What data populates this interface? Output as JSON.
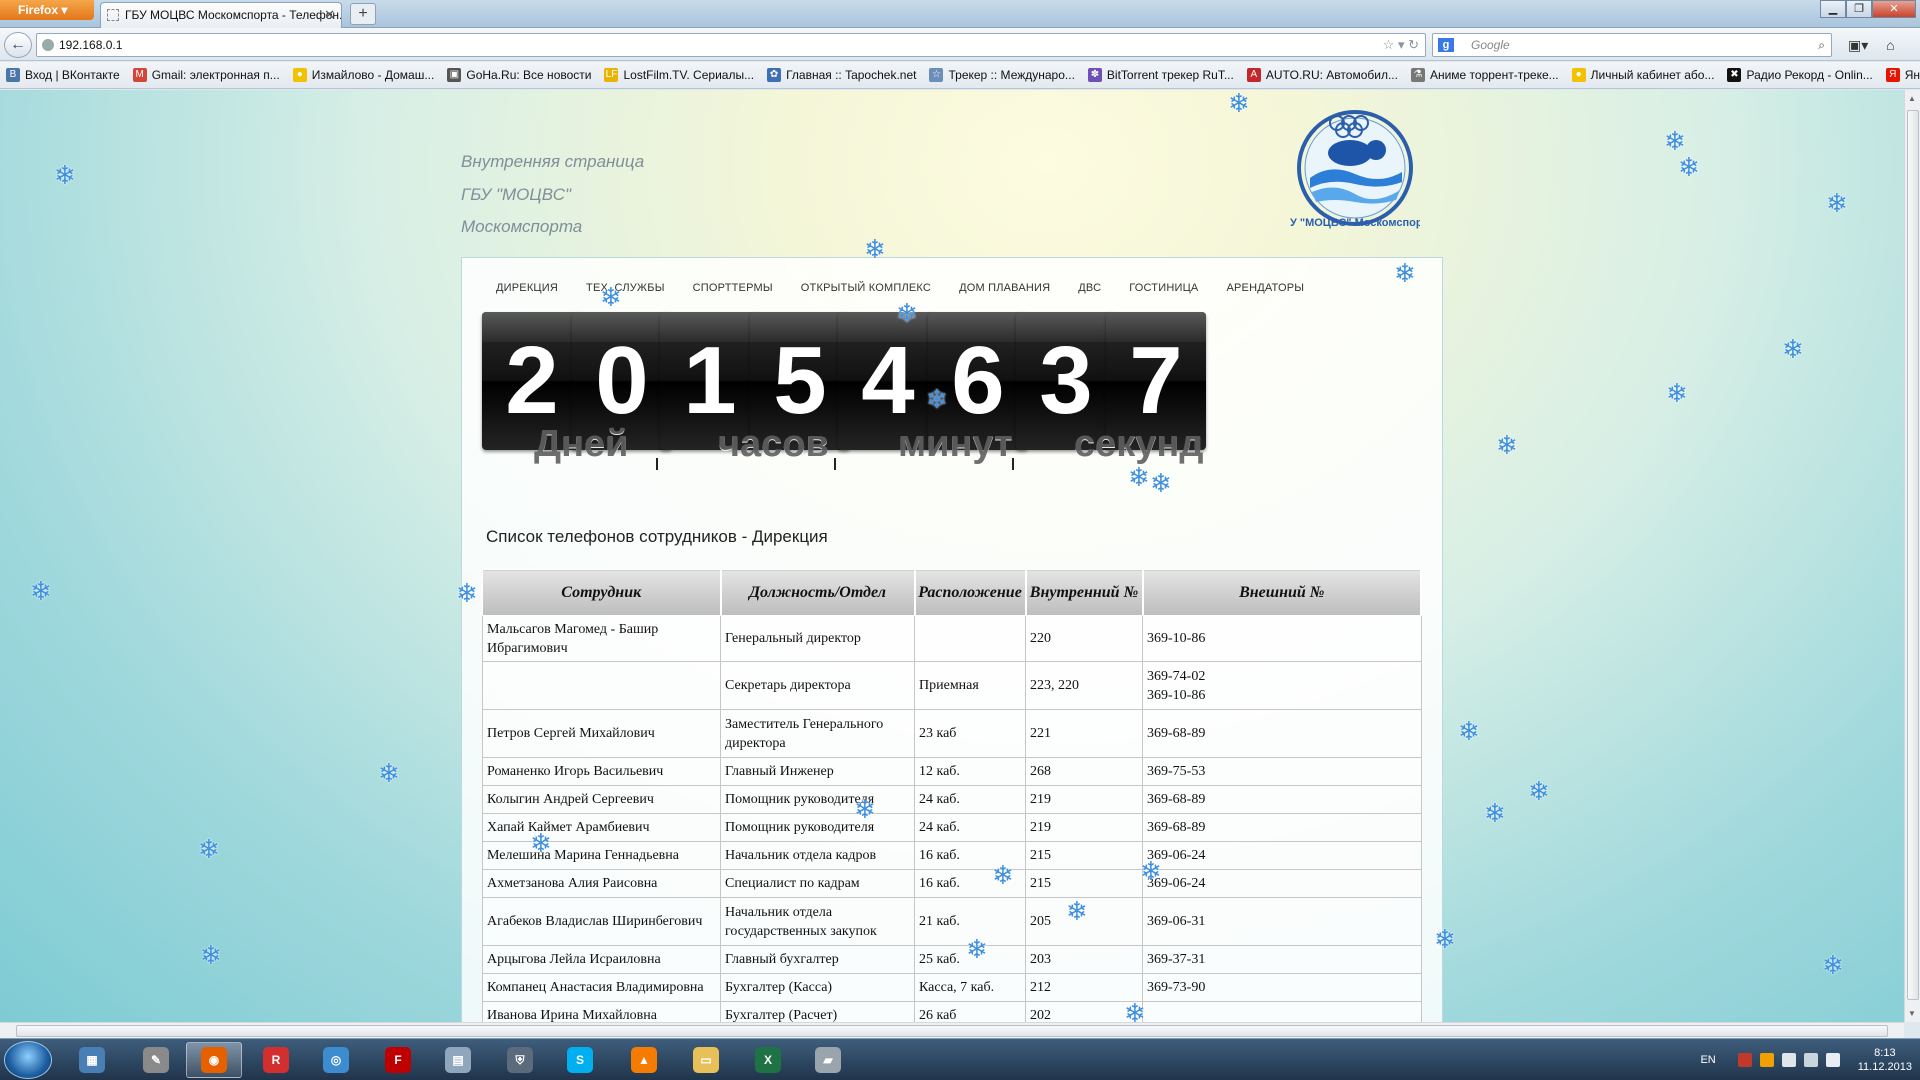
{
  "browser": {
    "menu_label": "Firefox",
    "tab_title": "ГБУ МОЦВС Москомспорта - Телефон...",
    "new_tab": "+",
    "url": "192.168.0.1",
    "search_placeholder": "Google",
    "bookmarks": [
      {
        "label": "Вход | ВКонтакте",
        "icon": "B",
        "color": "#4a76a8"
      },
      {
        "label": "Gmail: электронная п...",
        "icon": "M",
        "color": "#d44638"
      },
      {
        "label": "Измайлово - Домаш...",
        "icon": "●",
        "color": "#f2c200"
      },
      {
        "label": "GoHa.Ru: Все новости",
        "icon": "▣",
        "color": "#555555"
      },
      {
        "label": "LostFilm.TV. Сериалы...",
        "icon": "LF",
        "color": "#e8b400"
      },
      {
        "label": "Главная :: Tapochek.net",
        "icon": "✿",
        "color": "#3f6fb5"
      },
      {
        "label": "Трекер :: Междунаро...",
        "icon": "☆",
        "color": "#6a8fb8"
      },
      {
        "label": "BitTorrent трекер RuT...",
        "icon": "✽",
        "color": "#6f4fb5"
      },
      {
        "label": "AUTO.RU: Автомобил...",
        "icon": "A",
        "color": "#c3272b"
      },
      {
        "label": "Аниме торрент-треке...",
        "icon": "⚗",
        "color": "#777777"
      },
      {
        "label": "Личный кабинет або...",
        "icon": "●",
        "color": "#f2c200"
      },
      {
        "label": "Радио Рекорд - Onlin...",
        "icon": "✖",
        "color": "#111111"
      },
      {
        "label": "Яндекс",
        "icon": "Я",
        "color": "#e61400"
      }
    ]
  },
  "page": {
    "header_lines": [
      "Внутренняя страница",
      "ГБУ \"МОЦВС\"",
      "Москомспорта"
    ],
    "logo_text": "ГБУ \"МОЦВС\" Москомспорта",
    "menu": [
      "ДИРЕКЦИЯ",
      "ТЕХ. СЛУЖБЫ",
      "СПОРТТЕРМЫ",
      "ОТКРЫТЫЙ КОМПЛЕКС",
      "ДОМ ПЛАВАНИЯ",
      "ДВС",
      "ГОСТИНИЦА",
      "АРЕНДАТОРЫ"
    ],
    "countdown": {
      "digits": [
        "2",
        "0",
        "1",
        "5",
        "4",
        "6",
        "3",
        "7"
      ],
      "units": [
        "Дней",
        "часов",
        "минут",
        "секунд"
      ]
    },
    "list_title": "Список телефонов сотрудников - Дирекция",
    "table": {
      "headers": [
        "Сотрудник",
        "Должность/Отдел",
        "Расположение",
        "Внутренний №",
        "Внешний №"
      ],
      "rows": [
        [
          "Мальсагов Магомед - Башир Ибрагимович",
          "Генеральный директор",
          "",
          "220",
          "369-10-86"
        ],
        [
          "",
          "Секретарь директора",
          "Приемная",
          "223, 220",
          "369-74-02\n369-10-86"
        ],
        [
          "Петров Сергей Михайлович",
          "Заместитель Генерального директора",
          "23 каб",
          "221",
          "369-68-89"
        ],
        [
          "Романенко Игорь Васильевич",
          "Главный Инженер",
          "12 каб.",
          "268",
          "369-75-53"
        ],
        [
          "Колыгин Андрей Сергеевич",
          "Помощник руководителя",
          "24 каб.",
          "219",
          "369-68-89"
        ],
        [
          "Хапай Каймет Арамбиевич",
          "Помощник руководителя",
          "24 каб.",
          "219",
          "369-68-89"
        ],
        [
          "Мелешина Марина Геннадьевна",
          "Начальник отдела кадров",
          "16 каб.",
          "215",
          "369-06-24"
        ],
        [
          "Ахметзанова Алия Раисовна",
          "Специалист по кадрам",
          "16 каб.",
          "215",
          "369-06-24"
        ],
        [
          "Агабеков Владислав Ширинбегович",
          "Начальник отдела государственных закупок",
          "21 каб.",
          "205",
          "369-06-31"
        ],
        [
          "Арцыгова Лейла Исраиловна",
          "Главный бухгалтер",
          "25 каб.",
          "203",
          "369-37-31"
        ],
        [
          "Компанец Анастасия Владимировна",
          "Бухгалтер (Касса)",
          "Касса, 7 каб.",
          "212",
          "369-73-90"
        ],
        [
          "Иванова Ирина Михайловна",
          "Бухгалтер (Расчет)",
          "26 каб",
          "202",
          ""
        ]
      ]
    }
  },
  "taskbar": {
    "apps": [
      {
        "icon": "network-icon",
        "glyph": "▦",
        "color": "#4a7fb5"
      },
      {
        "icon": "paint-icon",
        "glyph": "✎",
        "color": "#8a8a8a"
      },
      {
        "icon": "firefox-icon",
        "glyph": "◉",
        "color": "#e66000"
      },
      {
        "icon": "app-r-icon",
        "glyph": "R",
        "color": "#d32f2f"
      },
      {
        "icon": "webcam-icon",
        "glyph": "◎",
        "color": "#3c8ccf"
      },
      {
        "icon": "filezilla-icon",
        "glyph": "F",
        "color": "#bf0000"
      },
      {
        "icon": "calculator-icon",
        "glyph": "▤",
        "color": "#8fa6bd"
      },
      {
        "icon": "shield-icon",
        "glyph": "⛨",
        "color": "#5b6b7b"
      },
      {
        "icon": "skype-icon",
        "glyph": "S",
        "color": "#00aff0"
      },
      {
        "icon": "vlc-icon",
        "glyph": "▲",
        "color": "#f57c00"
      },
      {
        "icon": "folder-icon",
        "glyph": "▭",
        "color": "#e8c05a"
      },
      {
        "icon": "excel-icon",
        "glyph": "X",
        "color": "#1f7244"
      },
      {
        "icon": "scanner-icon",
        "glyph": "▰",
        "color": "#9aa4ad"
      }
    ],
    "lang": "EN",
    "time": "8:13",
    "date": "11.12.2013"
  }
}
